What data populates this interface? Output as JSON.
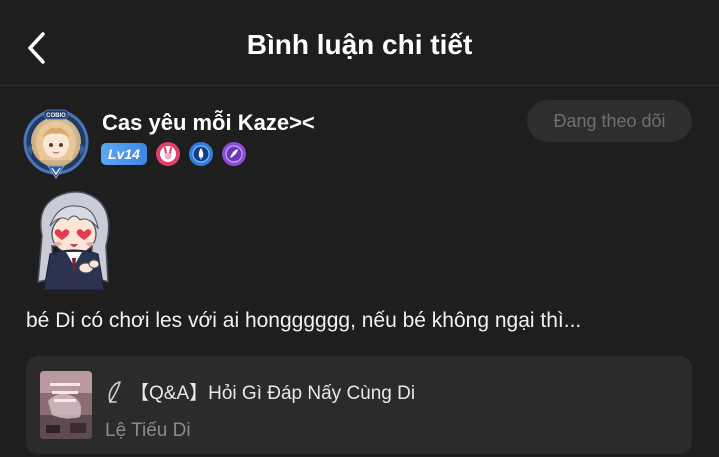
{
  "header": {
    "title": "Bình luận chi tiết",
    "back_icon": "chevron-left-icon"
  },
  "user": {
    "name": "Cas yêu mỗi Kaze><",
    "level": "Lv14",
    "avatar_frame_label": "COBIO",
    "medals": [
      {
        "icon": "rabbit-medal-icon",
        "color": "#e0406a"
      },
      {
        "icon": "rocket-medal-icon",
        "color": "#2f7fe0"
      },
      {
        "icon": "feather-medal-icon",
        "color": "#8a4fd8"
      }
    ]
  },
  "follow_button": {
    "label": "Đang theo dõi"
  },
  "comment": {
    "sticker": "anime-girl-heart-eyes-sticker",
    "text": "bé Di có chơi les với ai hongggggg, nếu bé không ngại thì..."
  },
  "linked_post": {
    "title": "【Q&A】Hỏi Gì Đáp Nấy Cùng Di",
    "author": "Lệ Tiếu Di",
    "icon": "quill-icon"
  },
  "colors": {
    "background": "#1e1e1e",
    "card": "#2b2b2b",
    "button": "#2e2e2e",
    "level_badge": "#4a96ee"
  }
}
